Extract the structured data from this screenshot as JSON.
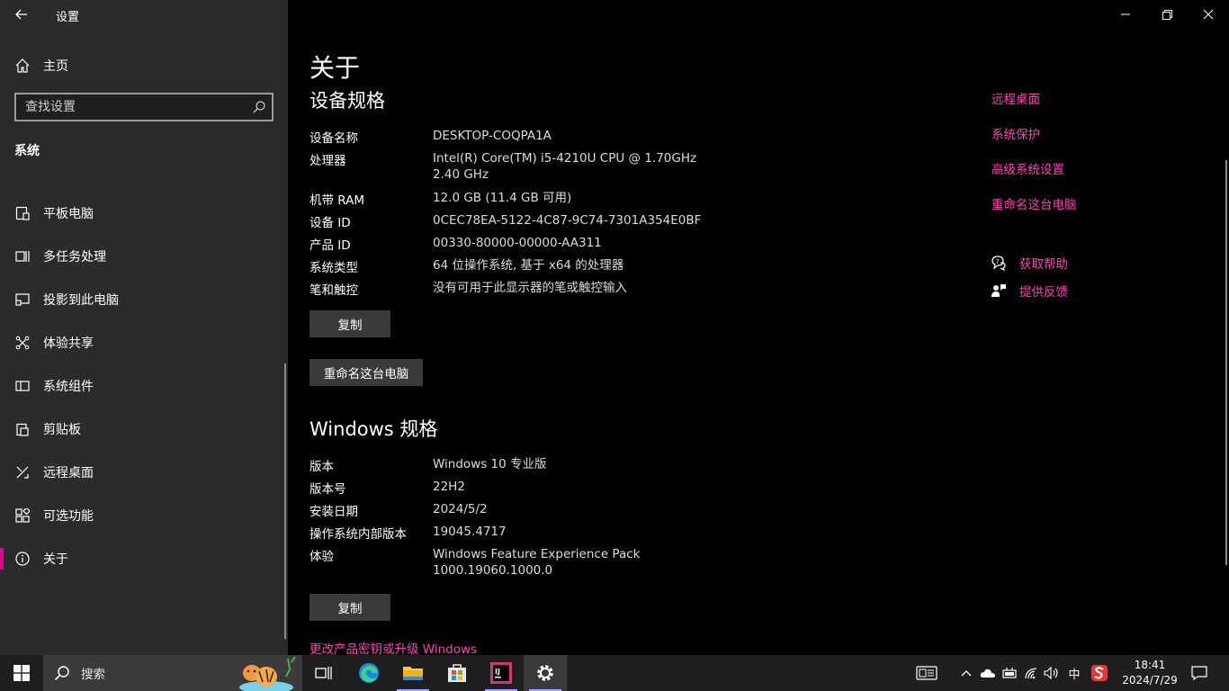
{
  "window": {
    "title": "设置"
  },
  "sidebar": {
    "home_label": "主页",
    "search_placeholder": "查找设置",
    "section_title": "系统",
    "items": [
      {
        "label": "平板电脑",
        "icon": "tablet-icon"
      },
      {
        "label": "多任务处理",
        "icon": "multitasking-icon"
      },
      {
        "label": "投影到此电脑",
        "icon": "projection-icon"
      },
      {
        "label": "体验共享",
        "icon": "shared-experiences-icon"
      },
      {
        "label": "系统组件",
        "icon": "system-components-icon"
      },
      {
        "label": "剪贴板",
        "icon": "clipboard-icon"
      },
      {
        "label": "远程桌面",
        "icon": "remote-desktop-icon"
      },
      {
        "label": "可选功能",
        "icon": "optional-features-icon"
      },
      {
        "label": "关于",
        "icon": "info-icon",
        "active": true
      }
    ]
  },
  "main": {
    "title": "关于",
    "device_specs": {
      "heading": "设备规格",
      "rows": [
        {
          "key": "设备名称",
          "value": "DESKTOP-COQPA1A"
        },
        {
          "key": "处理器",
          "value": "Intel(R) Core(TM) i5-4210U CPU @ 1.70GHz   2.40 GHz"
        },
        {
          "key": "机带 RAM",
          "value": "12.0 GB (11.4 GB 可用)"
        },
        {
          "key": "设备 ID",
          "value": "0CEC78EA-5122-4C87-9C74-7301A354E0BF"
        },
        {
          "key": "产品 ID",
          "value": "00330-80000-00000-AA311"
        },
        {
          "key": "系统类型",
          "value": "64 位操作系统, 基于 x64 的处理器"
        },
        {
          "key": "笔和触控",
          "value": "没有可用于此显示器的笔或触控输入"
        }
      ],
      "copy_label": "复制",
      "rename_label": "重命名这台电脑"
    },
    "windows_specs": {
      "heading": "Windows 规格",
      "rows": [
        {
          "key": "版本",
          "value": "Windows 10 专业版"
        },
        {
          "key": "版本号",
          "value": "22H2"
        },
        {
          "key": "安装日期",
          "value": "2024/5/2"
        },
        {
          "key": "操作系统内部版本",
          "value": "19045.4717"
        },
        {
          "key": "体验",
          "value": "Windows Feature Experience Pack 1000.19060.1000.0"
        }
      ],
      "copy_label": "复制",
      "change_key_link": "更改产品密钥或升级 Windows"
    }
  },
  "related": {
    "links": [
      "远程桌面",
      "系统保护",
      "高级系统设置",
      "重命名这台电脑"
    ],
    "get_help": "获取帮助",
    "give_feedback": "提供反馈"
  },
  "taskbar": {
    "search_label": "搜索",
    "tray_ime": "中",
    "time": "18:41",
    "date": "2024/7/29"
  },
  "colors": {
    "accent": "#e3008c",
    "link": "#ff3fb4",
    "sidebar_bg": "#2b2b2b",
    "taskbar_bg": "#1f1f1f"
  }
}
